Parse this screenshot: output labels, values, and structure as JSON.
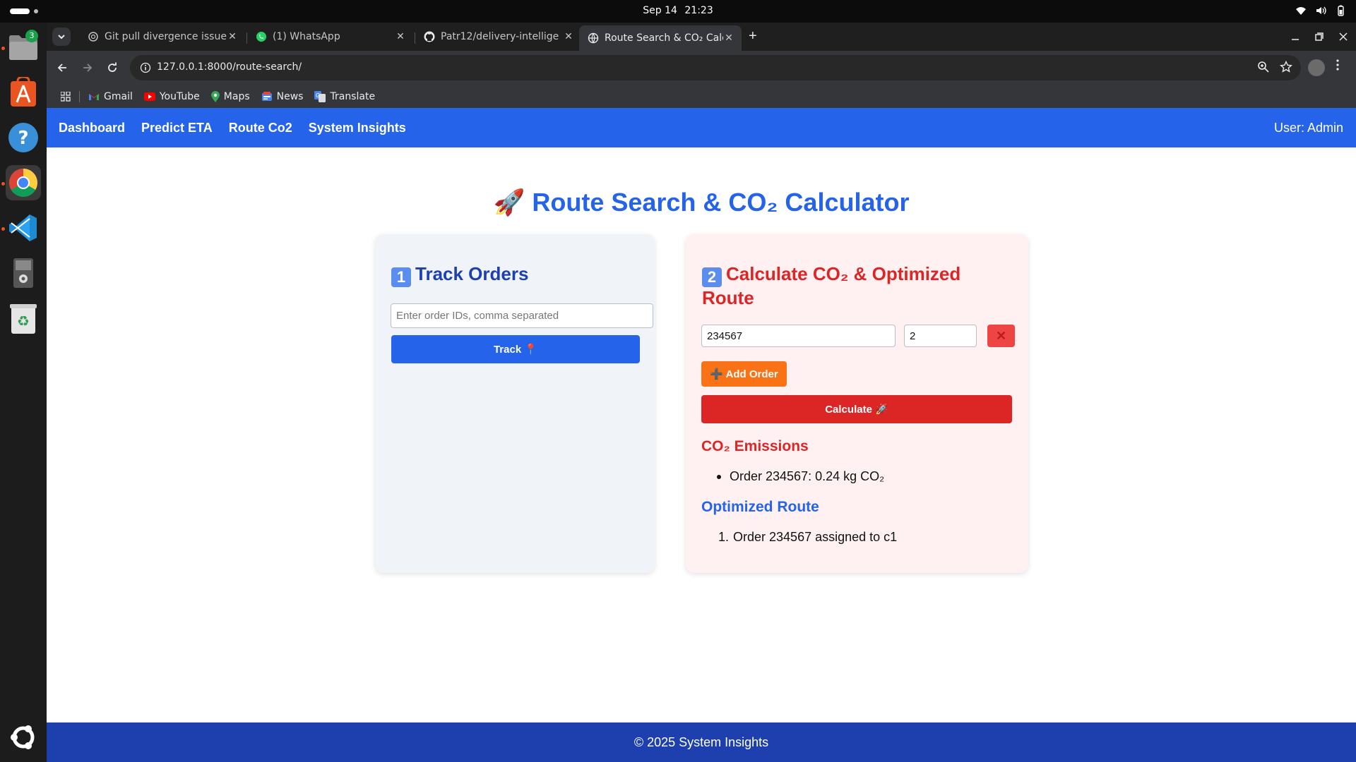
{
  "system": {
    "date": "Sep 14",
    "time": "21:23",
    "files_badge": "3"
  },
  "dock": {
    "items": [
      "files-icon",
      "app-center-icon",
      "help-icon",
      "chrome-icon",
      "vscode-icon",
      "drive-icon",
      "trash-icon",
      "show-apps-icon"
    ]
  },
  "browser": {
    "tabs": [
      {
        "title": "Git pull divergence issue",
        "icon": "chatgpt-icon"
      },
      {
        "title": "(1) WhatsApp",
        "icon": "whatsapp-icon"
      },
      {
        "title": "Patr12/delivery-intellige",
        "icon": "github-icon"
      },
      {
        "title": "Route Search & CO₂ Calc",
        "icon": "globe-icon"
      }
    ],
    "url": "127.0.0.1:8000/route-search/",
    "bookmarks": [
      {
        "label": "Gmail",
        "icon": "gmail-icon"
      },
      {
        "label": "YouTube",
        "icon": "youtube-icon"
      },
      {
        "label": "Maps",
        "icon": "maps-icon"
      },
      {
        "label": "News",
        "icon": "news-icon"
      },
      {
        "label": "Translate",
        "icon": "translate-icon"
      }
    ]
  },
  "nav": {
    "links": [
      "Dashboard",
      "Predict ETA",
      "Route Co2",
      "System Insights"
    ],
    "user": "User: Admin"
  },
  "page": {
    "title": "🚀 Route Search & CO₂ Calculator"
  },
  "track": {
    "number": "1",
    "heading": "Track Orders",
    "placeholder": "Enter order IDs, comma separated",
    "button": "Track 📍"
  },
  "calc": {
    "number": "2",
    "heading": "Calculate CO₂ & Optimized Route",
    "order_id_value": "234567",
    "quantity_value": "2",
    "remove_button": "✕",
    "add_button": "➕ Add Order",
    "calculate_button": "Calculate 🚀",
    "emissions_heading": "CO₂ Emissions",
    "emissions": [
      "Order 234567: 0.24 kg CO₂"
    ],
    "route_heading": "Optimized Route",
    "route_steps": [
      {
        "num": "1.",
        "text": "Order 234567 assigned to c1"
      }
    ]
  },
  "footer": {
    "text": "© 2025 System Insights"
  },
  "colors": {
    "primary": "#2563eb",
    "dark_blue": "#1e40af",
    "red": "#dc2626",
    "orange": "#f97316"
  }
}
